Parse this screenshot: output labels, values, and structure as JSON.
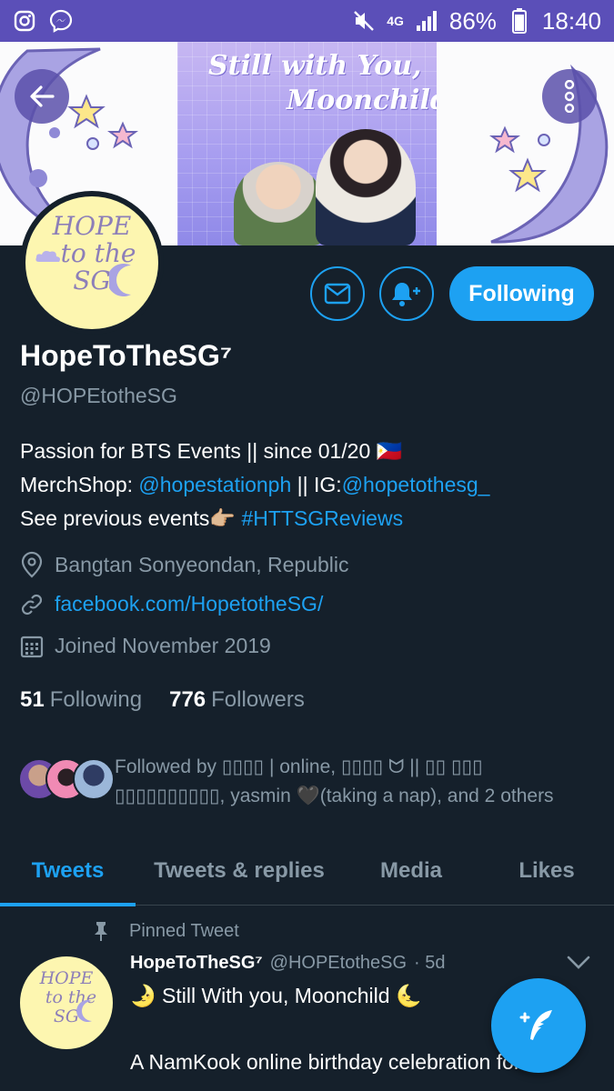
{
  "status_bar": {
    "network": "4G",
    "battery": "86%",
    "time": "18:40",
    "icons": [
      "instagram-icon",
      "messenger-icon",
      "mute-icon",
      "signal-icon",
      "battery-icon"
    ],
    "color": "#5b4fb8"
  },
  "banner": {
    "title_line1": "Still with You,",
    "title_line2": "Moonchild"
  },
  "profile": {
    "avatar_line1": "HOPE",
    "avatar_line2": "to the",
    "avatar_line3": "SG",
    "follow_button": "Following",
    "name": "HopeToTheSG⁷",
    "handle": "@HOPEtotheSG",
    "bio_line1": "Passion for BTS Events || since 01/20 🇵🇭",
    "bio_line2_prefix": "MerchShop: ",
    "bio_line2_link1": "@hopestationph",
    "bio_line2_mid": " || IG:",
    "bio_line2_link2": "@hopetothesg_",
    "bio_line3_prefix": "See previous events👉🏼 ",
    "bio_line3_link": "#HTTSGReviews",
    "location": "Bangtan Sonyeondan, Republic",
    "website": "facebook.com/HopetotheSG/",
    "joined": "Joined November 2019",
    "following_count": "51",
    "following_label": "Following",
    "followers_count": "776",
    "followers_label": "Followers",
    "followed_by": "Followed by ▯▯▯▯ | online, ▯▯▯▯ ᗢ || ▯▯ ▯▯▯ ▯▯▯▯▯▯▯▯▯▯, yasmin 🖤(taking a nap), and 2 others"
  },
  "tabs": [
    {
      "label": "Tweets",
      "active": true
    },
    {
      "label": "Tweets & replies",
      "active": false
    },
    {
      "label": "Media",
      "active": false
    },
    {
      "label": "Likes",
      "active": false
    }
  ],
  "pinned_tweet": {
    "pinned_label": "Pinned Tweet",
    "avatar_line1": "HOPE",
    "avatar_line2": "to the",
    "avatar_line3": "SG",
    "author_name": "HopeToTheSG⁷",
    "author_handle": "@HOPEtotheSG",
    "time": "· 5d",
    "line1": "🌛 Still With you, Moonchild 🌜",
    "line2": "A NamKook online birthday celebration for a"
  },
  "colors": {
    "background": "#15202b",
    "accent": "#1da1f2",
    "muted": "#8899a6"
  }
}
